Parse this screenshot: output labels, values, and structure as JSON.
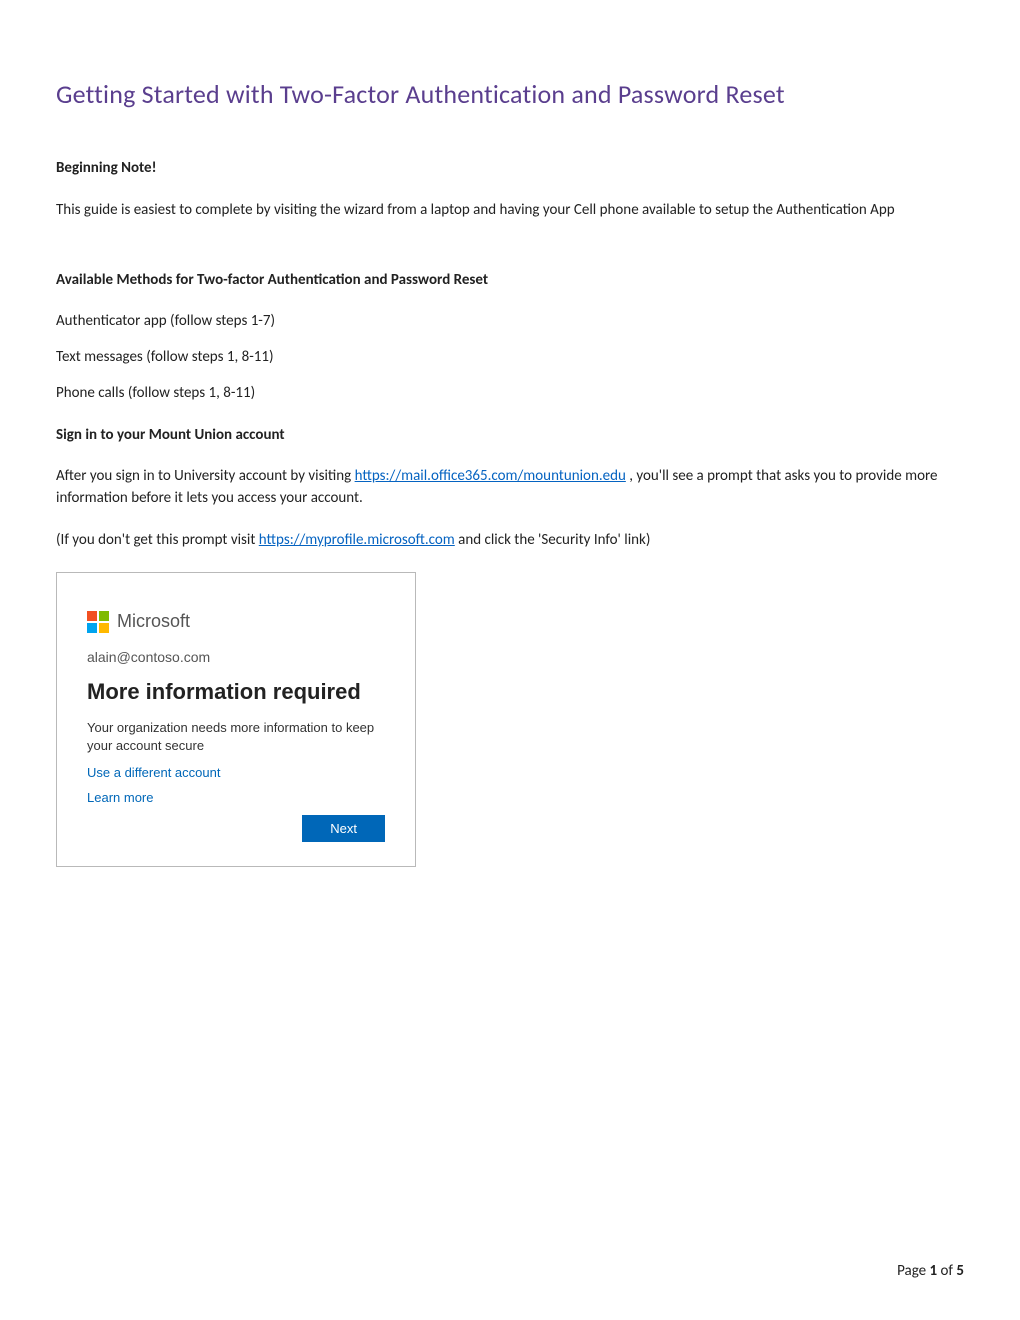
{
  "title": "Getting Started with Two-Factor Authentication and Password Reset",
  "note_heading": "Beginning Note!",
  "note_text": "This guide is easiest to complete by visiting the wizard from a laptop and having your Cell phone available to setup the Authentication App",
  "methods_heading": "Available Methods for Two-factor Authentication and Password Reset",
  "methods": {
    "m1": " Authenticator app (follow steps 1-7)",
    "m2": " Text messages (follow steps 1, 8-11)",
    "m3": " Phone calls (follow steps 1, 8-11)"
  },
  "signin_heading": "Sign in to your Mount Union account",
  "signin_pre": "After you sign in to University account by visiting ",
  "signin_link1": "https://mail.office365.com/mountunion.edu",
  "signin_post": " , you'll see a prompt that asks you to provide more information before it lets you access your account.",
  "alt_pre": " (If you don't get this prompt visit ",
  "alt_link": "https://myprofile.microsoft.com",
  "alt_post": " and click the 'Security Info' link)",
  "dialog": {
    "brand": "Microsoft",
    "email": "alain@contoso.com",
    "heading": "More information required",
    "desc": "Your organization needs more information to keep your account secure",
    "different_account": "Use a different account",
    "learn_more": "Learn more",
    "next": "Next"
  },
  "footer": {
    "prefix": "Page ",
    "current": "1",
    "of": " of ",
    "total": "5"
  }
}
